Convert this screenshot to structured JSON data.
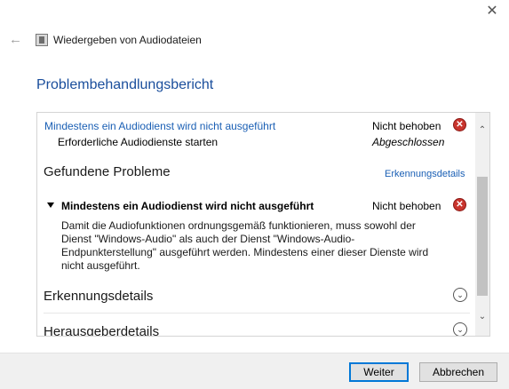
{
  "window": {
    "app_title": "Wiedergeben von Audiodateien",
    "page_title": "Problembehandlungsbericht"
  },
  "report": {
    "issue_link": "Mindestens ein Audiodienst wird nicht ausgeführt",
    "issue_status": "Nicht behoben",
    "sub_action": "Erforderliche Audiodienste starten",
    "sub_status": "Abgeschlossen",
    "found_heading": "Gefundene Probleme",
    "detection_link": "Erkennungsdetails",
    "problem_title": "Mindestens ein Audiodienst wird nicht ausgeführt",
    "problem_status": "Nicht behoben",
    "problem_desc": "Damit die Audiofunktionen ordnungsgemäß funktionieren, muss sowohl der Dienst \"Windows-Audio\" als auch der Dienst \"Windows-Audio-Endpunkterstellung\" ausgeführt werden. Mindestens einer dieser Dienste wird nicht ausgeführt.",
    "section_detection": "Erkennungsdetails",
    "section_publisher": "Herausgeberdetails"
  },
  "buttons": {
    "next": "Weiter",
    "cancel": "Abbrechen"
  },
  "icons": {
    "close": "close-icon",
    "back": "back-arrow-icon",
    "error": "error-x-icon",
    "expand": "chevron-down-icon"
  },
  "colors": {
    "accent": "#1a4e9c",
    "link": "#1a5fb4",
    "error": "#c9342d"
  }
}
